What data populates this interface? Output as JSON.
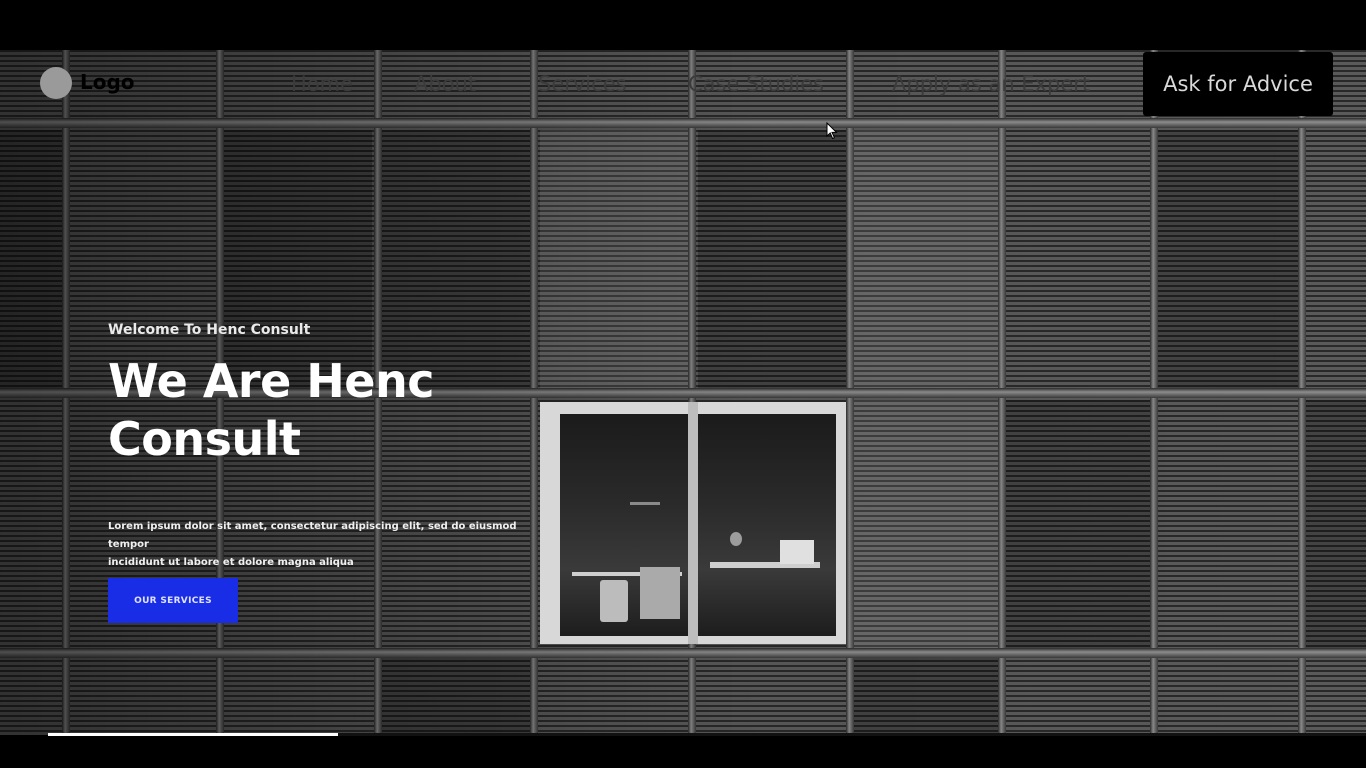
{
  "nav": {
    "logo_text": "Logo",
    "links": [
      "Home",
      "About",
      "Services",
      "Case Studies",
      "Apply as an Expert"
    ],
    "cta_label": "Ask for Advice"
  },
  "hero": {
    "eyebrow": "Welcome To Henc Consult",
    "headline_line1": "We Are Henc",
    "headline_line2": "Consult",
    "lede_line1": "Lorem ipsum dolor sit amet, consectetur adipiscing elit, sed do eiusmod tempor",
    "lede_line2": "incididunt ut labore et dolore magna aliqua",
    "button_label": "OUR SERVICES",
    "button_color": "#1a2de6"
  },
  "video": {
    "progress": 0.22
  }
}
